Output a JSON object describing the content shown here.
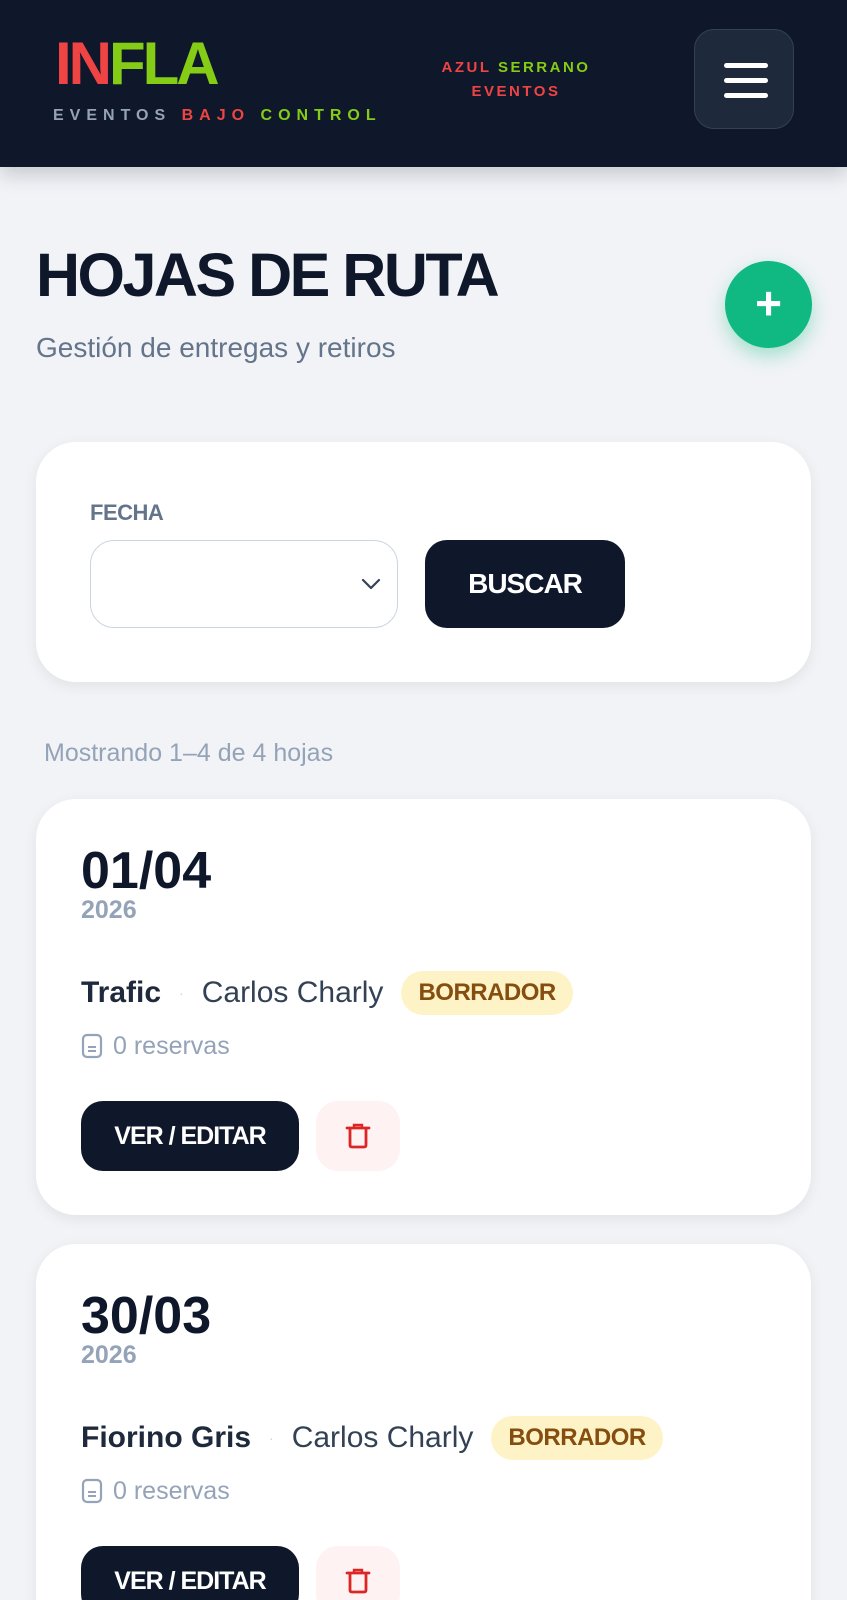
{
  "header": {
    "logo": {
      "part1": "IN",
      "part2": "FLA"
    },
    "tagline": {
      "word1": "EVENTOS",
      "word2": "BAJO",
      "word3": "CONTROL"
    },
    "company": {
      "word1": "AZUL",
      "word2": "SERRANO",
      "word3": "EVENTOS"
    },
    "menu_icon": "hamburger-menu-icon",
    "colors": {
      "background": "#0f172a",
      "red": "#ef4444",
      "green": "#84cc16",
      "muted": "#94a3b8"
    }
  },
  "page": {
    "title": "HOJAS DE RUTA",
    "subtitle": "Gestión de entregas y retiros",
    "add_icon": "+",
    "add_color": "#10b981"
  },
  "filter": {
    "label": "FECHA",
    "date_value": "",
    "search_label": "BUSCAR"
  },
  "results": {
    "count_text": "Mostrando 1–4 de 4 hojas"
  },
  "routes": [
    {
      "day_month": "01/04",
      "year": "2026",
      "vehicle": "Trafic",
      "separator": "·",
      "driver": "Carlos Charly",
      "status": "BORRADOR",
      "reservations": "0 reservas",
      "edit_label": "VER / EDITAR"
    },
    {
      "day_month": "30/03",
      "year": "2026",
      "vehicle": "Fiorino Gris",
      "separator": "·",
      "driver": "Carlos Charly",
      "status": "BORRADOR",
      "reservations": "0 reservas",
      "edit_label": "VER / EDITAR"
    }
  ],
  "status_colors": {
    "draft_bg": "#fef3c7",
    "draft_text": "#854d0e"
  }
}
